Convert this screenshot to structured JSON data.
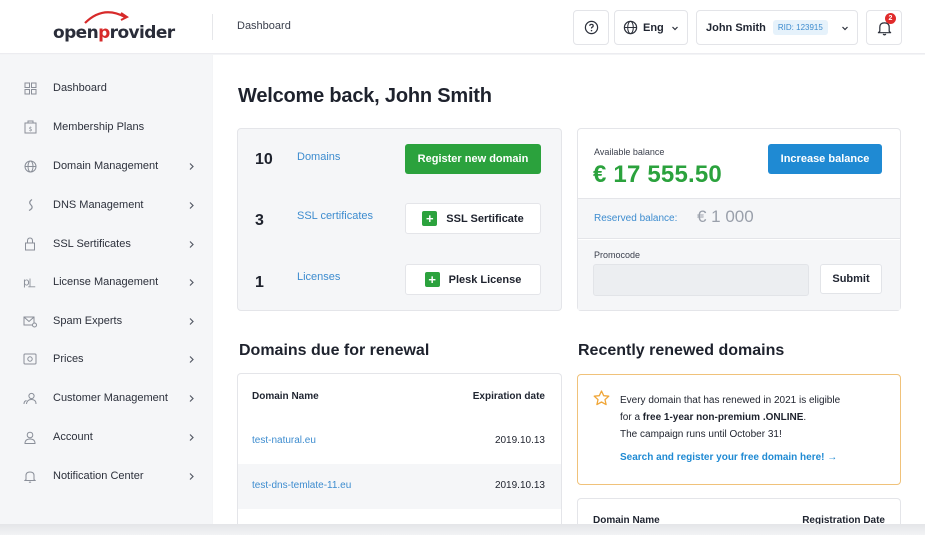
{
  "brand": {
    "logo_prefix": "open",
    "logo_accent": "p",
    "logo_suffix": "rovider",
    "logo_color": "#2a2d39",
    "accent_color": "#d72a2a"
  },
  "header": {
    "breadcrumb": "Dashboard",
    "help_icon": "question-circle-icon",
    "language": "Eng",
    "user_name": "John Smith",
    "rid": "RID: 123915",
    "notification_count": "2"
  },
  "sidebar": {
    "items": [
      {
        "label": "Dashboard",
        "icon": "grid-icon",
        "has_chevron": false
      },
      {
        "label": "Membership Plans",
        "icon": "membership-icon",
        "has_chevron": false
      },
      {
        "label": "Domain Management",
        "icon": "globe-icon",
        "has_chevron": true
      },
      {
        "label": "DNS Management",
        "icon": "dns-icon",
        "has_chevron": true
      },
      {
        "label": "SSL Sertificates",
        "icon": "lock-icon",
        "has_chevron": true
      },
      {
        "label": "License Management",
        "icon": "license-icon",
        "has_chevron": true
      },
      {
        "label": "Spam Experts",
        "icon": "mail-shield-icon",
        "has_chevron": true
      },
      {
        "label": "Prices",
        "icon": "prices-icon",
        "has_chevron": true
      },
      {
        "label": "Customer Management",
        "icon": "customers-icon",
        "has_chevron": true
      },
      {
        "label": "Account",
        "icon": "user-icon",
        "has_chevron": true
      },
      {
        "label": "Notification Center",
        "icon": "bell-icon",
        "has_chevron": true
      }
    ]
  },
  "main": {
    "welcome": "Welcome back, John Smith",
    "stats": [
      {
        "count": "10",
        "label": "Domains",
        "action": "Register new domain"
      },
      {
        "count": "3",
        "label": "SSL certificates",
        "action": "SSL Sertificate"
      },
      {
        "count": "1",
        "label": "Licenses",
        "action": "Plesk License"
      }
    ],
    "balance": {
      "label": "Available balance",
      "amount": "€ 17 555.50",
      "increase_button": "Increase balance",
      "reserved_label": "Reserved balance:",
      "reserved_amount": "€ 1 000",
      "promocode_label": "Promocode",
      "promocode_value": "",
      "submit_button": "Submit"
    },
    "renewal": {
      "title": "Domains due for renewal",
      "columns": [
        "Domain Name",
        "Expiration date"
      ],
      "rows": [
        {
          "name": "test-natural.eu",
          "date": "2019.10.13"
        },
        {
          "name": "test-dns-temlate-11.eu",
          "date": "2019.10.13"
        }
      ]
    },
    "recent": {
      "title": "Recently renewed domains",
      "note_line1": "Every domain that has renewed in 2021 is eligible",
      "note_line2_prefix": "for a ",
      "note_line2_bold": "free 1-year non-premium .ONLINE",
      "note_line2_suffix": ".",
      "note_line3": "The campaign runs until October 31!",
      "note_link": "Search and register your free domain here! →",
      "columns": [
        "Domain Name",
        "Registration Date"
      ]
    }
  },
  "colors": {
    "green": "#2ba23d",
    "blue": "#1f8ad3",
    "link": "#3d8ccf",
    "badge_red": "#e02b2b",
    "note_border": "#f0c27a"
  }
}
